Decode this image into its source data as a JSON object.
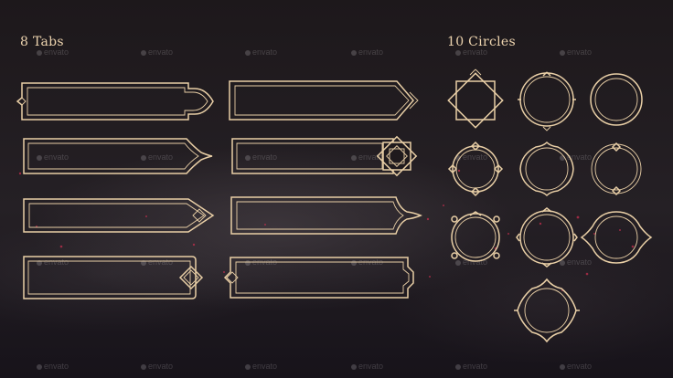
{
  "headings": {
    "tabs": "8 Tabs",
    "circles": "10 Circles"
  },
  "watermark": {
    "text": "envato",
    "icon": "envato-leaf-icon"
  },
  "colors": {
    "background": "#1c1719",
    "frame_gold": "#e9cfa6",
    "sparkle": "#c22f4e"
  },
  "tabs": [
    {
      "id": "tab-1"
    },
    {
      "id": "tab-2"
    },
    {
      "id": "tab-3"
    },
    {
      "id": "tab-4"
    },
    {
      "id": "tab-5"
    },
    {
      "id": "tab-6"
    },
    {
      "id": "tab-7"
    },
    {
      "id": "tab-8"
    }
  ],
  "circles": [
    {
      "id": "circle-1"
    },
    {
      "id": "circle-2"
    },
    {
      "id": "circle-3"
    },
    {
      "id": "circle-4"
    },
    {
      "id": "circle-5"
    },
    {
      "id": "circle-6"
    },
    {
      "id": "circle-7"
    },
    {
      "id": "circle-8"
    },
    {
      "id": "circle-9"
    },
    {
      "id": "circle-10"
    }
  ]
}
